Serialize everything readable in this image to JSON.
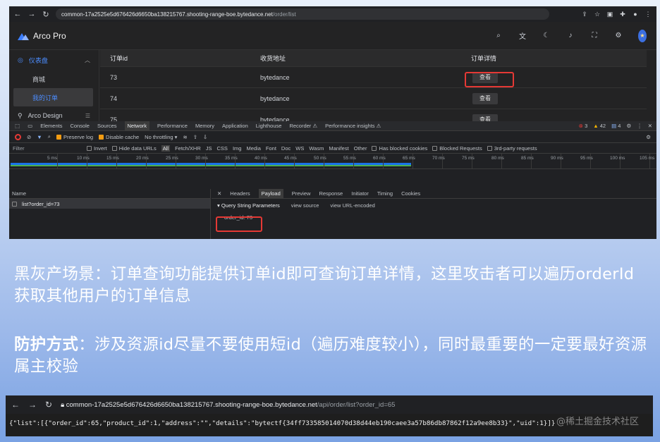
{
  "browser_top": {
    "url_host": "common-17a2525e5d676426d6650ba138215767.shooting-range-boe.bytedance.net",
    "url_path": "/order/list"
  },
  "app": {
    "title": "Arco Pro",
    "sidebar": {
      "group_label": "仪表盘",
      "items": [
        {
          "label": "商城"
        },
        {
          "label": "我的订单"
        }
      ],
      "design_label": "Arco Design"
    },
    "table": {
      "headers": [
        "订单id",
        "收货地址",
        "订单详情"
      ],
      "rows": [
        {
          "order_id": "73",
          "address": "bytedance",
          "action": "查看"
        },
        {
          "order_id": "74",
          "address": "bytedance",
          "action": "查看"
        },
        {
          "order_id": "75",
          "address": "bytedance",
          "action": "查看"
        }
      ]
    }
  },
  "devtools": {
    "tabs": [
      "Elements",
      "Console",
      "Sources",
      "Network",
      "Performance",
      "Memory",
      "Application",
      "Lighthouse",
      "Recorder ⚠",
      "Performance insights ⚠"
    ],
    "active_tab": "Network",
    "counts": {
      "errors": "3",
      "warnings": "42",
      "info": "4"
    },
    "toolbar": {
      "preserve_log": "Preserve log",
      "disable_cache": "Disable cache",
      "throttle": "No throttling"
    },
    "filter": {
      "placeholder": "Filter",
      "options": [
        "Invert",
        "Hide data URLs",
        "All",
        "Fetch/XHR",
        "JS",
        "CSS",
        "Img",
        "Media",
        "Font",
        "Doc",
        "WS",
        "Wasm",
        "Manifest",
        "Other",
        "Has blocked cookies",
        "Blocked Requests",
        "3rd-party requests"
      ]
    },
    "timeline_labels": [
      "5 ms",
      "10 ms",
      "15 ms",
      "20 ms",
      "25 ms",
      "30 ms",
      "35 ms",
      "40 ms",
      "45 ms",
      "50 ms",
      "55 ms",
      "60 ms",
      "65 ms",
      "70 ms",
      "75 ms",
      "80 ms",
      "85 ms",
      "90 ms",
      "95 ms",
      "100 ms",
      "105 ms"
    ],
    "name_header": "Name",
    "request_name": "list?order_id=73",
    "detail_tabs": [
      "Headers",
      "Payload",
      "Preview",
      "Response",
      "Initiator",
      "Timing",
      "Cookies"
    ],
    "active_detail_tab": "Payload",
    "query_title": "▾ Query String Parameters",
    "view_source": "view source",
    "view_url_encoded": "view URL-encoded",
    "param": "order_id: 73"
  },
  "text": {
    "para1": "黑灰产场景：订单查询功能提供订单id即可查询订单详情，这里攻击者可以遍历orderId获取其他用户的订单信息",
    "para2_bold": "防护方式",
    "para2_rest": "：涉及资源id尽量不要使用短id（遍历难度较小），同时最重要的一定要最好资源属主校验"
  },
  "browser_bottom": {
    "url_host": "common-17a2525e5d676426d6650ba138215767.shooting-range-boe.bytedance.net",
    "url_path": "/api/order/list?order_id=65",
    "json": "{\"list\":[{\"order_id\":65,\"product_id\":1,\"address\":\"\",\"details\":\"bytectf{34ff733585014070d38d44eb190caee3a57b86db87862f12a9ee8b33}\",\"uid\":1}]}"
  },
  "watermark": "@稀土掘金技术社区"
}
